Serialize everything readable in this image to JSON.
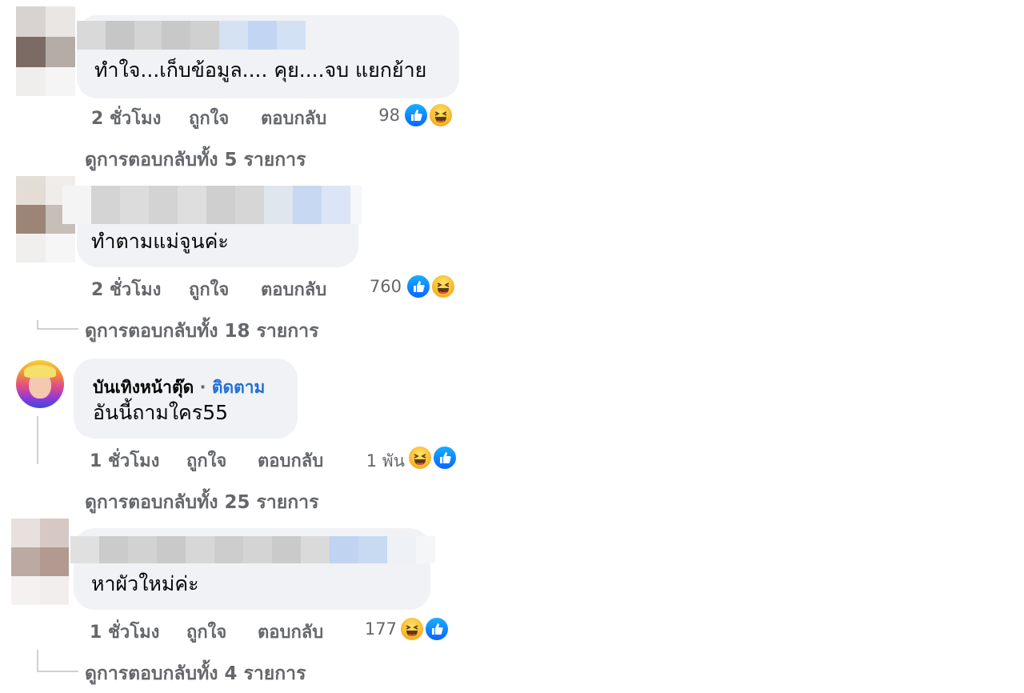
{
  "comments": [
    {
      "author": "",
      "text": "ทำใจ...เก็บข้อมูล.... คุย....จบ แยกย้าย",
      "time": "2 ชั่วโมง",
      "like_label": "ถูกใจ",
      "reply_label": "ตอบกลับ",
      "reaction_count": "98",
      "reactions": [
        "like-icon",
        "haha-icon"
      ],
      "view_replies": "ดูการตอบกลับทั้ง 5 รายการ"
    },
    {
      "author": "",
      "text": "ทำตามแม่จูนค่ะ",
      "time": "2 ชั่วโมง",
      "like_label": "ถูกใจ",
      "reply_label": "ตอบกลับ",
      "reaction_count": "760",
      "reactions": [
        "like-icon",
        "haha-icon"
      ],
      "view_replies": "ดูการตอบกลับทั้ง 18 รายการ"
    },
    {
      "author": "บันเทิงหน้าตุ๊ด",
      "separator": "·",
      "follow_label": "ติดตาม",
      "text": "อันนี้ถามใคร55",
      "time": "1 ชั่วโมง",
      "like_label": "ถูกใจ",
      "reply_label": "ตอบกลับ",
      "reaction_count": "1 พัน",
      "reactions": [
        "haha-icon",
        "like-icon"
      ],
      "view_replies": "ดูการตอบกลับทั้ง 25 รายการ"
    },
    {
      "author": "",
      "text": "หาผัวใหม่ค่ะ",
      "time": "1 ชั่วโมง",
      "like_label": "ถูกใจ",
      "reply_label": "ตอบกลับ",
      "reaction_count": "177",
      "reactions": [
        "haha-icon",
        "like-icon"
      ],
      "view_replies": "ดูการตอบกลับทั้ง 4 รายการ"
    }
  ],
  "colors": {
    "bubble": "#f0f2f5",
    "meta_text": "#65676b",
    "follow": "#216fdb",
    "like_blue": "#0866ff",
    "haha_yellow": "#f7b125"
  }
}
